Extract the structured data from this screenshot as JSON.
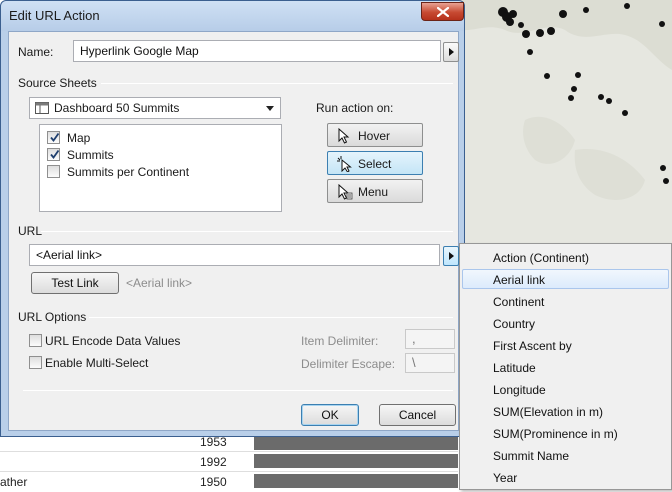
{
  "dialog": {
    "title": "Edit URL Action",
    "name_label": "Name:",
    "name_value": "Hyperlink Google Map",
    "source_sheets_label": "Source Sheets",
    "dashboard_value": "Dashboard 50 Summits",
    "sheets": [
      {
        "label": "Map",
        "checked": true
      },
      {
        "label": "Summits",
        "checked": true
      },
      {
        "label": "Summits per Continent",
        "checked": false
      }
    ],
    "run_action_label": "Run action on:",
    "run_actions": [
      {
        "label": "Hover",
        "selected": false,
        "icon": "pointer-icon"
      },
      {
        "label": "Select",
        "selected": true,
        "icon": "pointer-select-icon"
      },
      {
        "label": "Menu",
        "selected": false,
        "icon": "pointer-menu-icon"
      }
    ],
    "url_label": "URL",
    "url_value": "<Aerial link>",
    "test_link_label": "Test Link",
    "url_preview": "<Aerial link>",
    "url_options_label": "URL Options",
    "encode_label": "URL Encode Data Values",
    "multiselect_label": "Enable Multi-Select",
    "item_delimiter_label": "Item Delimiter:",
    "item_delimiter_value": ",",
    "delimiter_escape_label": "Delimiter Escape:",
    "delimiter_escape_value": "\\",
    "ok_label": "OK",
    "cancel_label": "Cancel"
  },
  "field_menu": {
    "items": [
      "Action (Continent)",
      "Aerial link",
      "Continent",
      "Country",
      "First Ascent by",
      "Latitude",
      "Longitude",
      "SUM(Elevation in m)",
      "SUM(Prominence in m)",
      "Summit Name",
      "Year"
    ],
    "highlighted": "Aerial link"
  },
  "background_table": {
    "rows": [
      {
        "name": "",
        "year": "1953"
      },
      {
        "name": "",
        "year": "1992"
      },
      {
        "name": "ather",
        "year": "1950"
      }
    ]
  },
  "colors": {
    "map_background": "#e6e7e0",
    "map_point": "#111111",
    "dialog_frame": "#b9cfe9",
    "selected_button": "#c4e5f6",
    "close_button": "#c74a32"
  }
}
